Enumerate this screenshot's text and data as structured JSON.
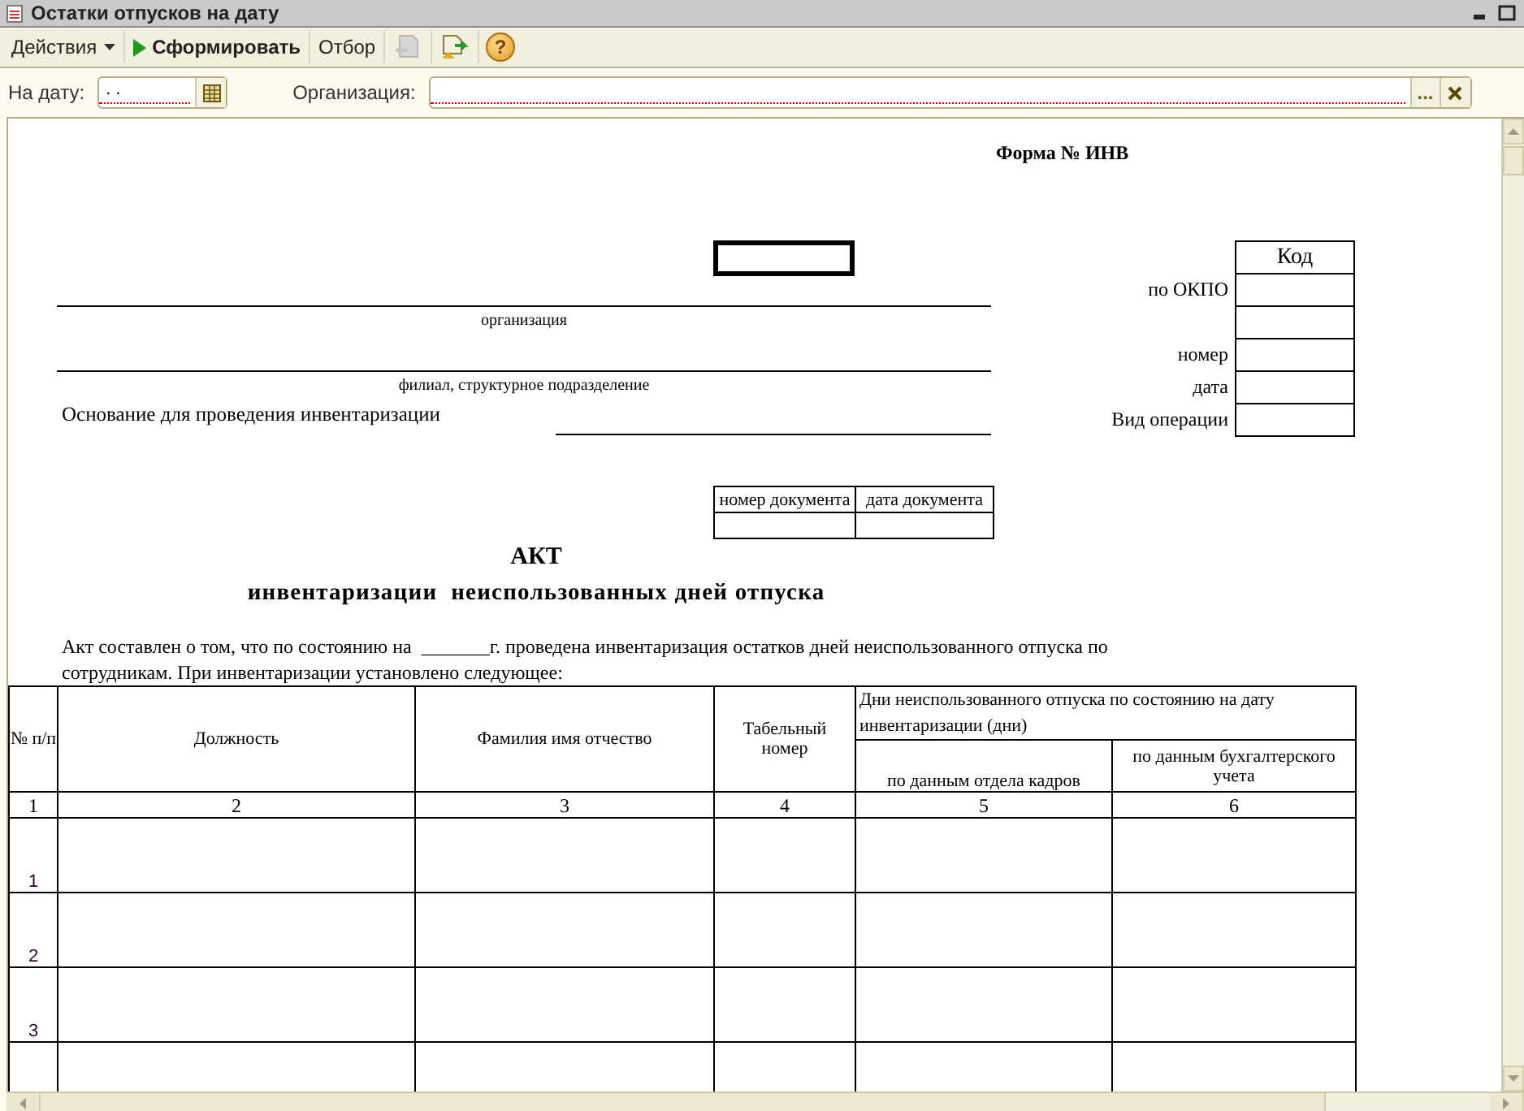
{
  "window": {
    "title": "Остатки отпусков на дату"
  },
  "toolbar": [
    {
      "kind": "menu",
      "label": "Действия",
      "disabled": false
    },
    {
      "kind": "run",
      "label": "Сформировать",
      "disabled": false
    },
    {
      "kind": "text",
      "label": "Отбор",
      "disabled": false
    },
    {
      "kind": "export",
      "disabled": true
    },
    {
      "kind": "import",
      "disabled": false
    },
    {
      "kind": "help",
      "label": "?",
      "disabled": false
    }
  ],
  "filters": [
    {
      "kind": "date",
      "label": "На дату:",
      "value": ". ."
    },
    {
      "kind": "reference",
      "label": "Организация:",
      "select_button": "..."
    }
  ],
  "document": {
    "form_label": "Форма № ИНВ",
    "captions": [
      "организация",
      "филиал, структурное подразделение"
    ],
    "basis_label": "Основание для проведения инвентаризации",
    "codes": {
      "header": "Код",
      "rows": [
        {
          "label": "по ОКПО"
        },
        {},
        {
          "label": "номер"
        },
        {
          "label": "дата"
        },
        {
          "label": "Вид операции"
        }
      ]
    },
    "doc_table": {
      "columns": [
        "номер документа",
        "дата документа"
      ]
    },
    "title": "АКТ",
    "subtitle": "инвентаризации  неиспользованных дней отпуска",
    "intro": "Акт составлен о том, что по состоянию на  _______г. проведена инвентаризация остатков дней неиспользованного отпуска по сотрудникам. При инвентаризации установлено следующее:",
    "table": {
      "columns": [
        "№ п/п",
        "Должность",
        "Фамилия имя отчество",
        "Табельный номер"
      ],
      "group_header": "Дни неиспользованного отпуска по состоянию на дату инвентаризации (дни)",
      "sub_columns": [
        "по данным отдела кадров",
        "по данным бухгалтерского учета"
      ],
      "column_numbers": [
        "1",
        "2",
        "3",
        "4",
        "5",
        "6"
      ],
      "rows": [
        {
          "number": "1"
        },
        {
          "number": "2"
        },
        {
          "number": "3"
        }
      ]
    }
  }
}
